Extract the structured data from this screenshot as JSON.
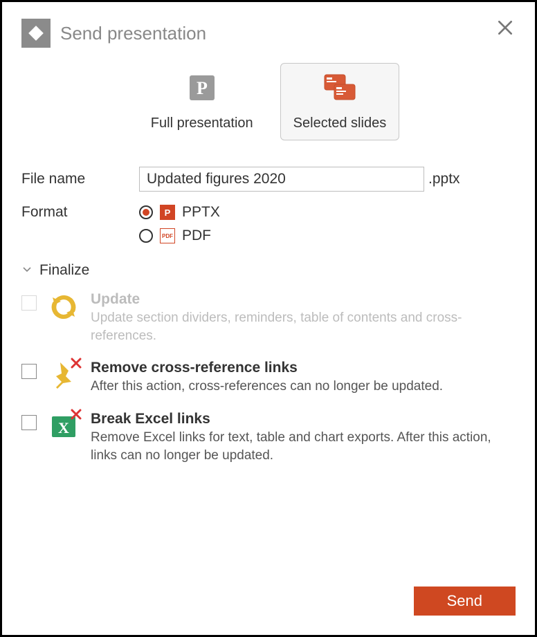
{
  "header": {
    "title": "Send presentation"
  },
  "modes": {
    "full": "Full presentation",
    "selected": "Selected slides"
  },
  "filename": {
    "label": "File name",
    "value": "Updated figures 2020",
    "ext": ".pptx"
  },
  "format": {
    "label": "Format",
    "pptx": "PPTX",
    "pdf": "PDF"
  },
  "finalize": {
    "header": "Finalize",
    "update": {
      "title": "Update",
      "desc": "Update section dividers, reminders, table of contents and cross-references."
    },
    "remove_refs": {
      "title": "Remove cross-reference links",
      "desc": "After this action, cross-references can no longer be updated."
    },
    "break_excel": {
      "title": "Break Excel links",
      "desc": "Remove Excel links for text, table and chart exports. After this action, links can no longer be updated."
    }
  },
  "buttons": {
    "send": "Send"
  }
}
